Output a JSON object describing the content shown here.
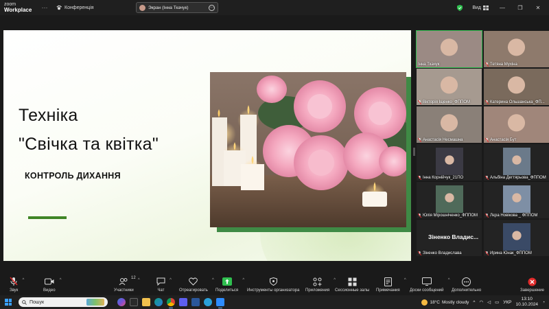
{
  "titlebar": {
    "brand_top": "zoom",
    "brand_bottom": "Workplace",
    "dots": "···",
    "conference_label": "Конференція",
    "share_label": "Экран (Інна Ткачук)",
    "view_label": "Вид"
  },
  "slide": {
    "title_line1": "Техніка",
    "title_line2": "\"Свічка та квітка\"",
    "subtitle": "КОНТРОЛЬ ДИХАННЯ"
  },
  "participants": [
    {
      "name": "Інна Ткачук",
      "muted": false,
      "active": true
    },
    {
      "name": "Тетяна Мухіна",
      "muted": true
    },
    {
      "name": "Вікторія Іщенко_ФППОМ",
      "muted": true
    },
    {
      "name": "Катерина Ольшанська_ФП...",
      "muted": true
    },
    {
      "name": "Анастасія Несмашна",
      "muted": true
    },
    {
      "name": "Анастасія Бут",
      "muted": true
    },
    {
      "name": "Інна Корнійчук_21ПО",
      "muted": true
    },
    {
      "name": "Альбіна Дегтярьова_ФППОМ",
      "muted": true
    },
    {
      "name": "Юлія Мірошніченко_ФППОМ",
      "muted": true
    },
    {
      "name": "Лєра Новікова _ ФППОМ",
      "muted": true
    },
    {
      "name": "Зіненко Владислава",
      "muted": true,
      "big_name": "Зіненко  Владис..."
    },
    {
      "name": "Ирина Юнак_ФППОМ",
      "muted": true
    }
  ],
  "toolbar": {
    "audio": "Звук",
    "video": "Видео",
    "participants": "Участники",
    "participants_count": "12",
    "chat": "Чат",
    "react": "Отреагировать",
    "share": "Поделиться",
    "host_tools": "Инструменты организатора",
    "apps": "Приложения",
    "rooms": "Сессионные залы",
    "notes": "Примечания",
    "whiteboard": "Доски сообщений",
    "more": "Дополнительно",
    "end": "Завершение"
  },
  "taskbar": {
    "search_placeholder": "Пошук",
    "weather_temp": "18°C",
    "weather_desc": "Mostly cloudy",
    "lang": "УКР",
    "time": "13:10",
    "date": "10.10.2024"
  },
  "colors": {
    "zoom_green": "#2fbf4f",
    "slide_accent": "#3f8526",
    "end_red": "#e02b2b"
  }
}
